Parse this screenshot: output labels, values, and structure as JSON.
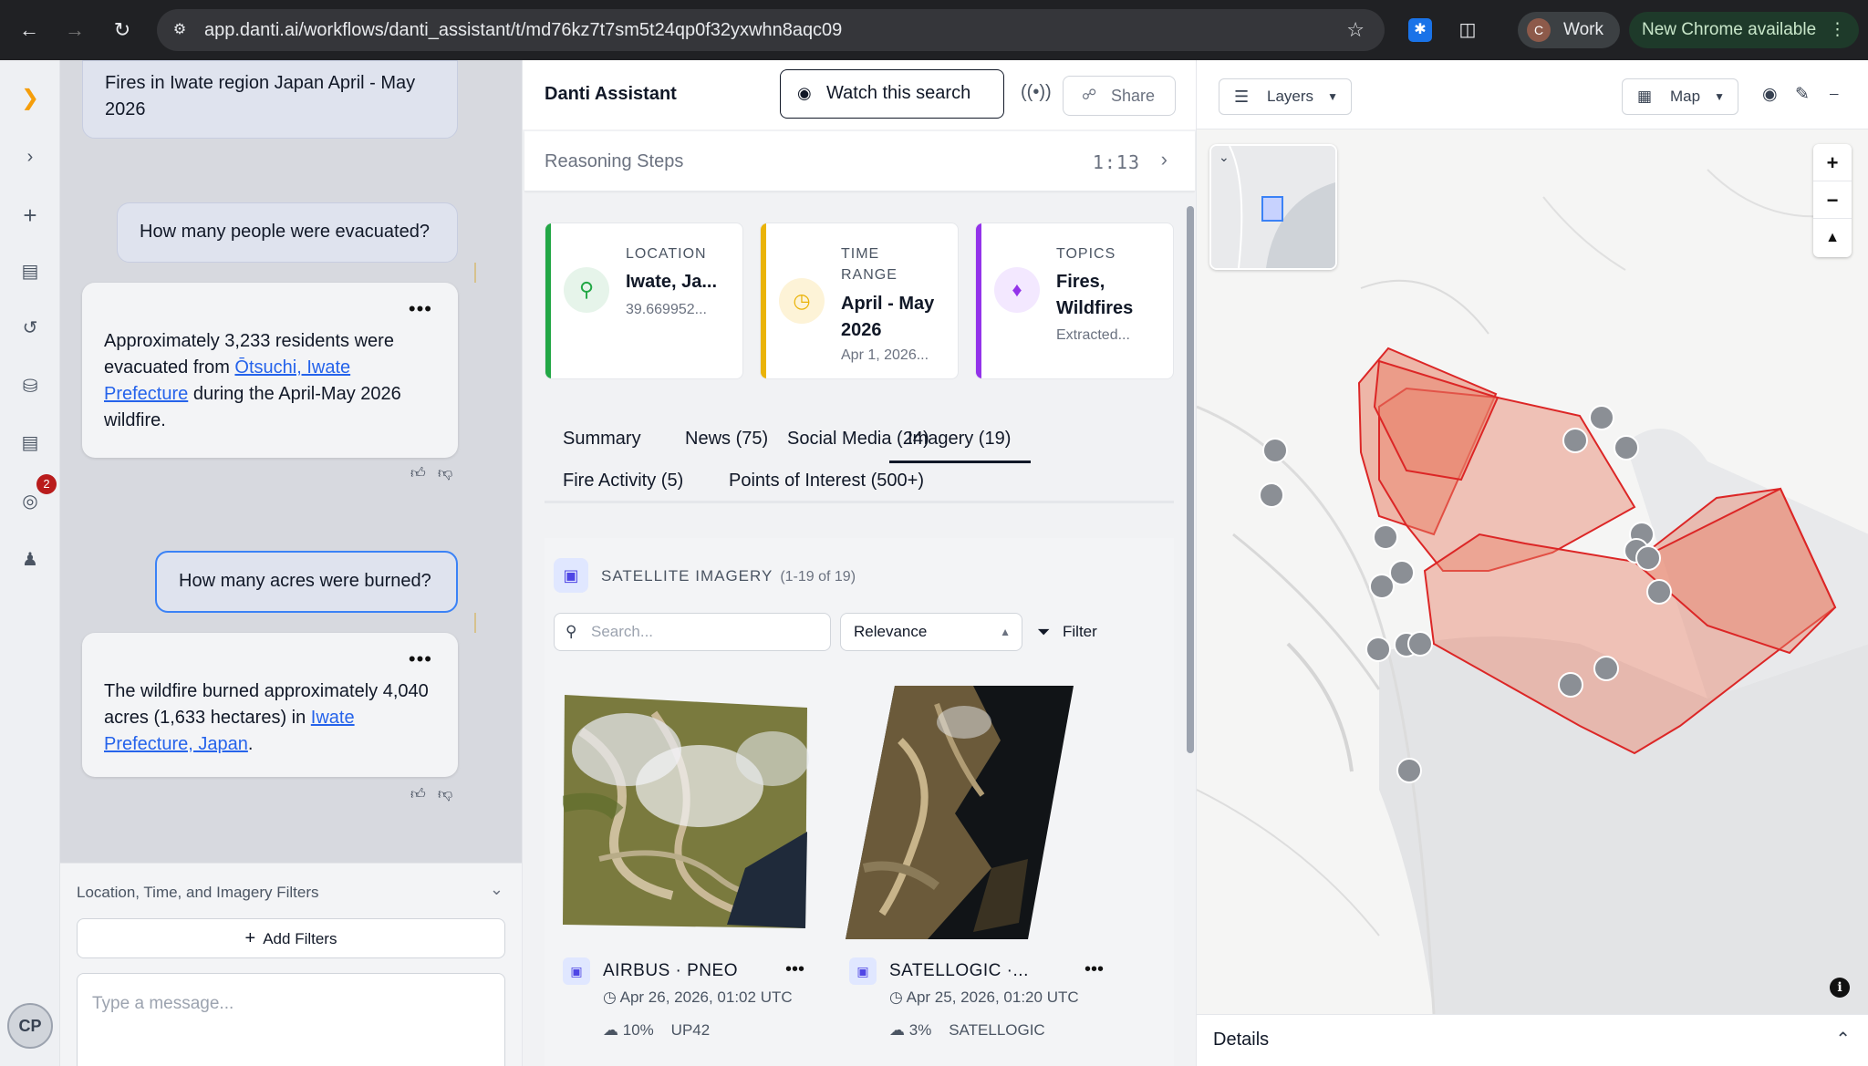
{
  "browser": {
    "url": "app.danti.ai/workflows/danti_assistant/t/md76kz7t7sm5t24qp0f32yxwhn8aqc09",
    "profile_initial": "C",
    "profile_label": "Work",
    "update_label": "New Chrome available"
  },
  "rail": {
    "notification_count": "2",
    "user_initials": "CP"
  },
  "chat": {
    "messages": [
      {
        "role": "user",
        "text": "Fires in Iwate region Japan April - May 2026"
      },
      {
        "role": "user",
        "text": "How many people were evacuated?"
      },
      {
        "role": "assistant",
        "text_before": "Approximately 3,233 residents were evacuated from",
        "link": "Ōtsuchi, Iwate Prefecture",
        "text_after": "during the April-May 2026 wildfire."
      },
      {
        "role": "user",
        "text": "How many acres were burned?"
      },
      {
        "role": "assistant",
        "text_before": "The wildfire burned approximately 4,040 acres (1,633 hectares) in",
        "link": "Iwate Prefecture, Japan",
        "text_after": "."
      }
    ],
    "filters_label": "Location, Time, and Imagery Filters",
    "add_filters_label": "Add Filters",
    "message_placeholder": "Type a message..."
  },
  "assistant": {
    "title": "Danti Assistant",
    "watch_label": "Watch this search",
    "share_label": "Share",
    "reasoning_label": "Reasoning Steps",
    "reasoning_time": "1:13",
    "cards": [
      {
        "kind": "LOCATION",
        "value": "Iwate, Ja...",
        "sub": "39.669952...",
        "color": "#22a745"
      },
      {
        "kind_line1": "TIME",
        "kind_line2": "RANGE",
        "value_line1": "April - May",
        "value_line2": "2026",
        "sub": "Apr 1, 2026...",
        "color": "#eab308"
      },
      {
        "kind": "TOPICS",
        "value_line1": "Fires,",
        "value_line2": "Wildfires",
        "sub": "Extracted...",
        "color": "#9333ea"
      }
    ],
    "tabs": [
      "Summary",
      "News (75)",
      "Social Media (24)",
      "Imagery (19)",
      "Fire Activity (5)",
      "Points of Interest (500+)"
    ],
    "active_tab": "Imagery (19)",
    "imagery": {
      "heading": "SATELLITE IMAGERY",
      "count": "(1-19 of 19)",
      "search_placeholder": "Search...",
      "sort_value": "Relevance",
      "filter_label": "Filter",
      "results": [
        {
          "provider": "AIRBUS · PNEO",
          "date": "Apr 26, 2026, 01:02 UTC",
          "cloud": "10%",
          "source": "UP42"
        },
        {
          "provider": "SATELLOGIC ·...",
          "date": "Apr 25, 2026, 01:20 UTC",
          "cloud": "3%",
          "source": "SATELLOGIC"
        }
      ]
    }
  },
  "map": {
    "layers_label": "Layers",
    "mode_label": "Map",
    "details_label": "Details",
    "fire_color": "#e8826a",
    "fire_stroke": "#dc2626"
  }
}
